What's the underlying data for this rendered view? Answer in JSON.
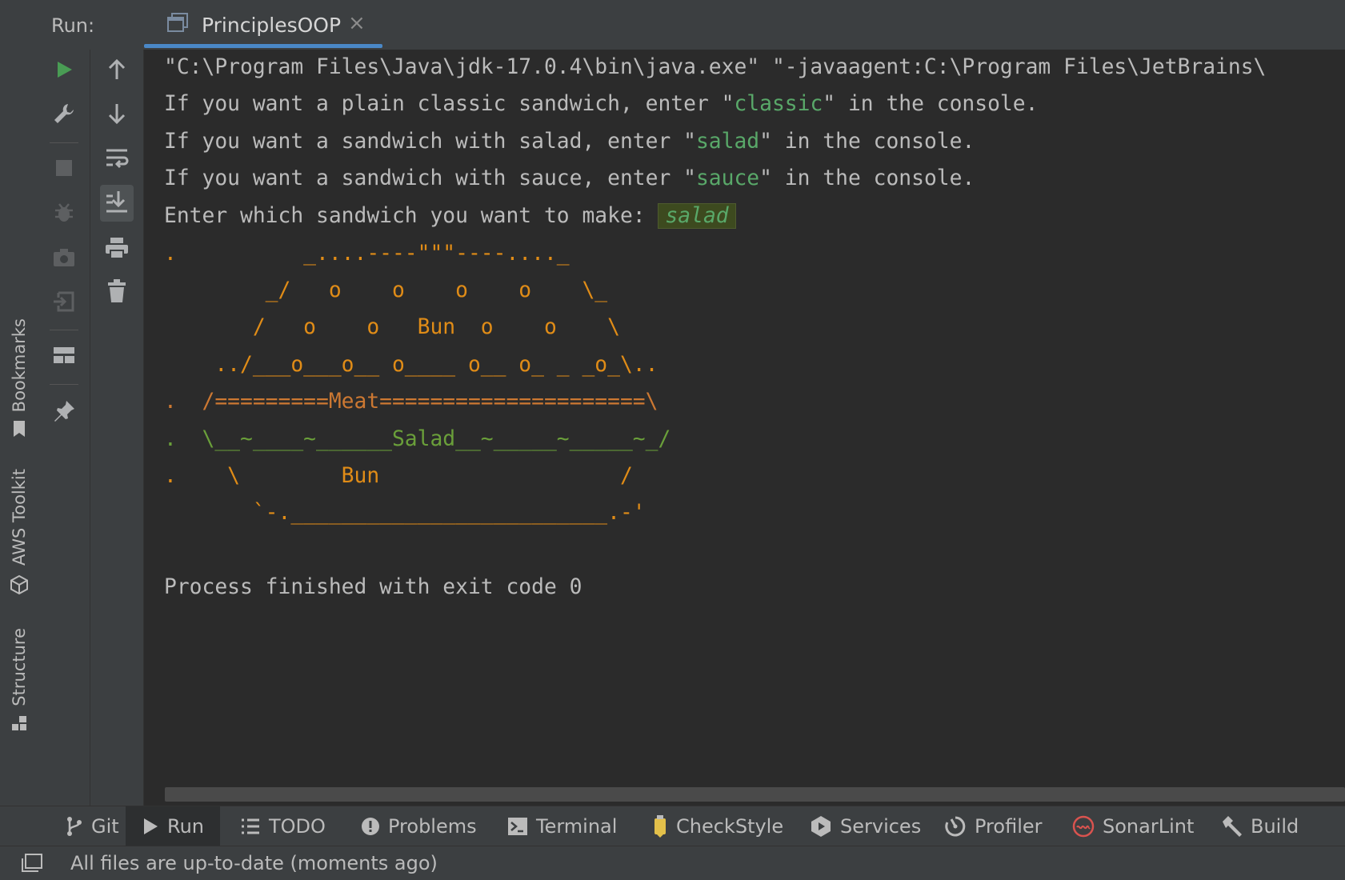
{
  "run_header": {
    "run_label": "Run:",
    "tab_title": "PrinciplesOOP",
    "close_glyph": "×"
  },
  "side_tabs": {
    "bookmarks": "Bookmarks",
    "aws_toolkit": "AWS Toolkit",
    "structure": "Structure"
  },
  "console": {
    "cmd_line": "\"C:\\Program Files\\Java\\jdk-17.0.4\\bin\\java.exe\" \"-javaagent:C:\\Program Files\\JetBrains\\",
    "lines": [
      {
        "pre": "If you want a plain classic sandwich, enter \"",
        "hl": "classic",
        "post": "\" in the console."
      },
      {
        "pre": "If you want a sandwich with salad, enter \"",
        "hl": "salad",
        "post": "\" in the console."
      },
      {
        "pre": "If you want a sandwich with sauce, enter \"",
        "hl": "sauce",
        "post": "\" in the console."
      }
    ],
    "prompt": "Enter which sandwich you want to make: ",
    "user_input": "salad",
    "art": [
      ".          _....----\"\"\"----...._",
      "        _/   o    o    o    o    \\_",
      "       /   o    o   Bun  o    o    \\",
      "    ../___o___o__ o____ o__ o_ _ _o_\\..",
      ".  /=========Meat=====================\\",
      ".  \\__~____~______Salad__~_____~_____~_/",
      ".    \\        Bun                   /",
      "       `-._________________________.-'"
    ],
    "finished": "Process finished with exit code 0"
  },
  "bottom_tabs": [
    {
      "label": "Git",
      "icon": "git-branch-icon"
    },
    {
      "label": "Run",
      "icon": "run-icon"
    },
    {
      "label": "TODO",
      "icon": "todo-list-icon"
    },
    {
      "label": "Problems",
      "icon": "problems-icon"
    },
    {
      "label": "Terminal",
      "icon": "terminal-icon"
    },
    {
      "label": "CheckStyle",
      "icon": "checkstyle-icon"
    },
    {
      "label": "Services",
      "icon": "services-icon"
    },
    {
      "label": "Profiler",
      "icon": "profiler-icon"
    },
    {
      "label": "SonarLint",
      "icon": "sonarlint-icon"
    },
    {
      "label": "Build",
      "icon": "hammer-icon"
    }
  ],
  "status_bar": {
    "text": "All files are up-to-date (moments ago)"
  },
  "colors": {
    "accent": "#4a88c7",
    "console_green": "#59a869",
    "art_orange": "#e08c17",
    "run_green": "#499c54"
  }
}
